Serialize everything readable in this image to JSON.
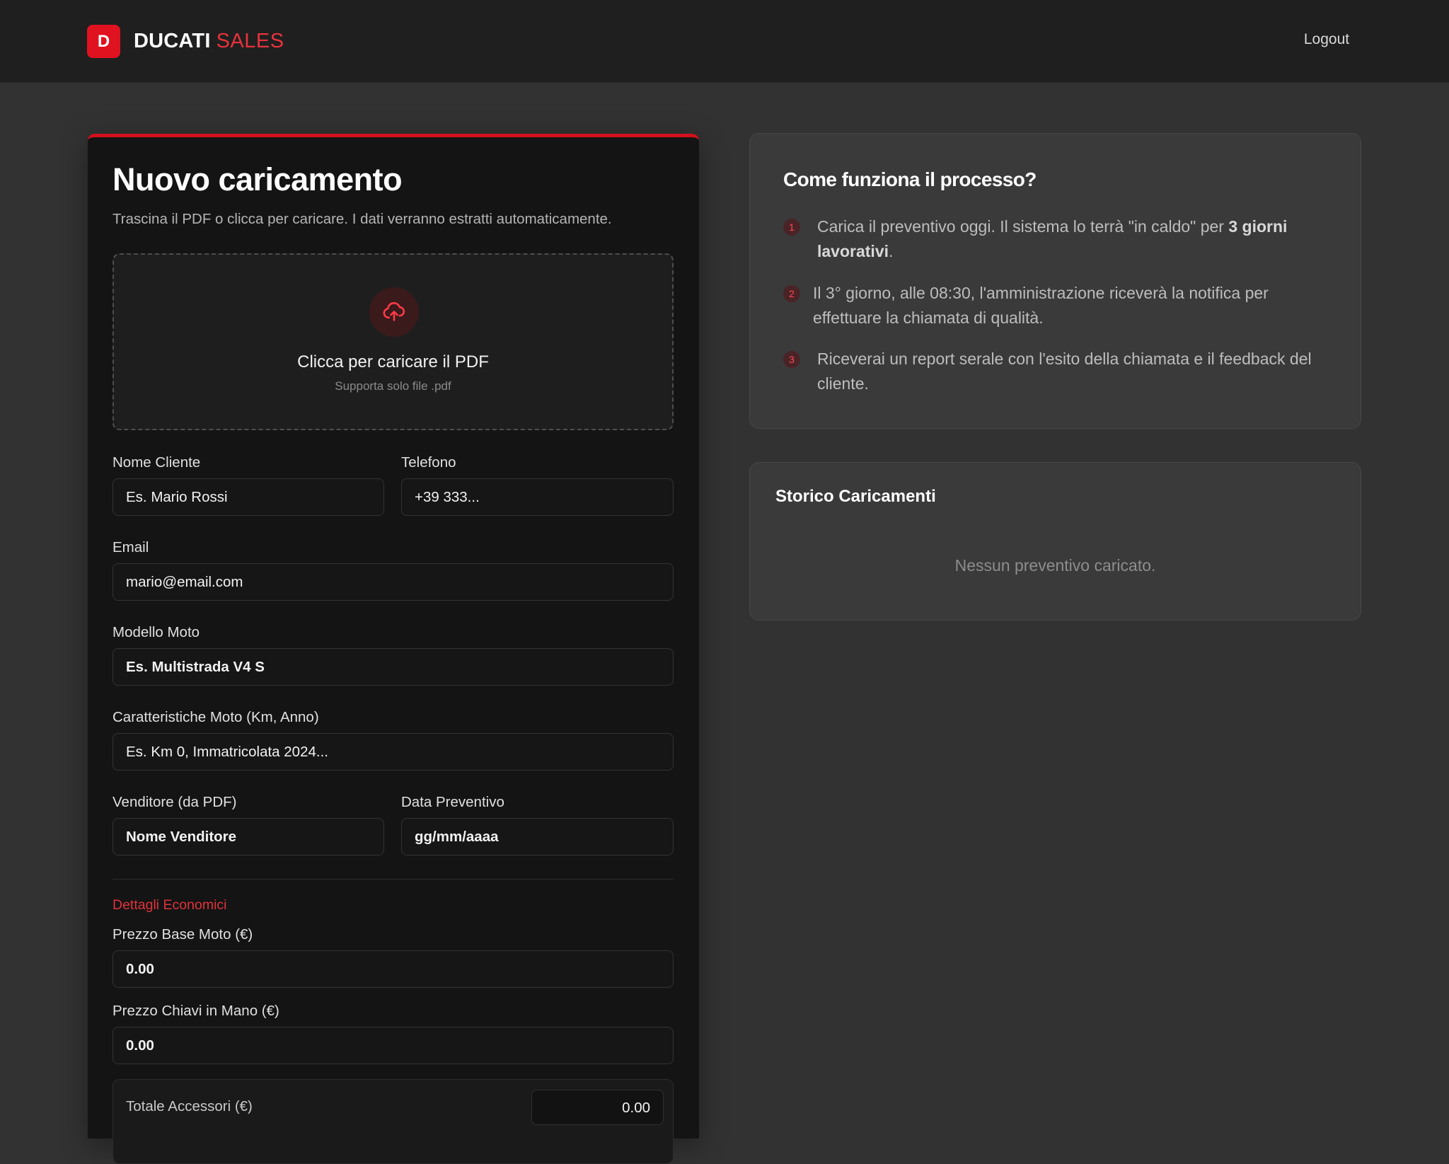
{
  "header": {
    "logo_letter": "D",
    "brand_name": "DUCATI",
    "brand_accent": "SALES",
    "logout_label": "Logout",
    "accent_color": "#e0121f"
  },
  "upload": {
    "title": "Nuovo caricamento",
    "subtitle": "Trascina il PDF o clicca per caricare. I dati verranno estratti automaticamente.",
    "dropzone": {
      "icon": "cloud-upload-icon",
      "title": "Clicca per caricare il PDF",
      "hint": "Supporta solo file .pdf"
    },
    "fields": {
      "nome_cliente": {
        "label": "Nome Cliente",
        "placeholder": "Es. Mario Rossi"
      },
      "telefono": {
        "label": "Telefono",
        "placeholder": "+39 333..."
      },
      "email": {
        "label": "Email",
        "placeholder": "mario@email.com"
      },
      "modello": {
        "label": "Modello Moto",
        "value": "Es. Multistrada V4 S"
      },
      "caratteristiche": {
        "label": "Caratteristiche Moto (Km, Anno)",
        "placeholder": "Es. Km 0, Immatricolata 2024..."
      },
      "venditore": {
        "label": "Venditore (da PDF)",
        "value": "Nome Venditore"
      },
      "data": {
        "label": "Data Preventivo",
        "value": "gg/mm/aaaa"
      }
    },
    "economics": {
      "section_label": "Dettagli Economici",
      "prezzo_base": {
        "label": "Prezzo Base Moto (€)",
        "value": "0.00"
      },
      "prezzo_chiavi": {
        "label": "Prezzo Chiavi in Mano (€)",
        "value": "0.00"
      },
      "totale_accessori": {
        "label": "Totale Accessori (€)",
        "value": "0.00"
      }
    }
  },
  "process": {
    "title": "Come funziona il processo?",
    "steps": [
      {
        "num": "1",
        "text_before": "Carica il preventivo oggi. Il sistema lo terrà \"in caldo\" per ",
        "bold": "3 giorni lavorativi",
        "text_after": "."
      },
      {
        "num": "2",
        "text": "Il 3° giorno, alle 08:30, l'amministrazione riceverà la notifica per effettuare la chiamata di qualità."
      },
      {
        "num": "3",
        "text": "Riceverai un report serale con l'esito della chiamata e il feedback del cliente."
      }
    ]
  },
  "history": {
    "title": "Storico Caricamenti",
    "empty_text": "Nessun preventivo caricato."
  }
}
